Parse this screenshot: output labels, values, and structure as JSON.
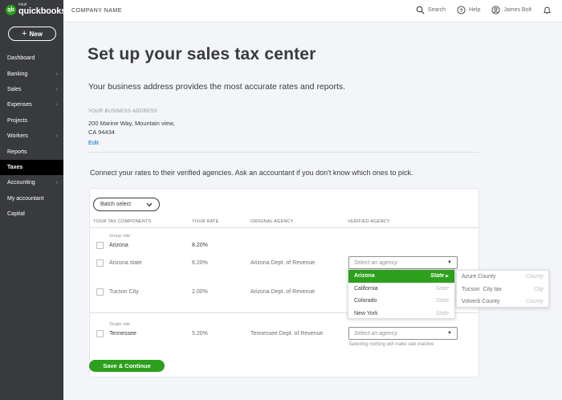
{
  "brand": {
    "intuit": "intuit",
    "name": "quickbooks",
    "mark": "qb",
    "accent": "#2ca01c"
  },
  "sidebar": {
    "new_label": "New",
    "items": [
      {
        "label": "Dashboard",
        "chevron": false
      },
      {
        "label": "Banking",
        "chevron": true
      },
      {
        "label": "Sales",
        "chevron": true
      },
      {
        "label": "Expenses",
        "chevron": true
      },
      {
        "label": "Projects",
        "chevron": false
      },
      {
        "label": "Workers",
        "chevron": true
      },
      {
        "label": "Reports",
        "chevron": false
      },
      {
        "label": "Taxes",
        "chevron": false,
        "active": true
      },
      {
        "label": "Accounting",
        "chevron": true
      },
      {
        "label": "My accountant",
        "chevron": false
      },
      {
        "label": "Capital",
        "chevron": false
      }
    ]
  },
  "topbar": {
    "company": "COMPANY NAME",
    "search": "Search",
    "help": "Help",
    "user": "James Bolt"
  },
  "page": {
    "title": "Set up your sales tax center",
    "subtitle": "Your business address provides the most accurate rates and reports.",
    "address_label": "YOUR BUSINESS ADDRESS",
    "address_line1": "200 Marine Way, Mountain view,",
    "address_line2": "CA 94434",
    "edit": "Edit",
    "connect": "Connect your rates to their verified agencies. Ask an accountant if you don't know which ones to pick."
  },
  "table": {
    "batch_label": "Batch select",
    "headers": [
      "YOUR TAX COMPONENTS",
      "YOUR RATE",
      "ORIGINAL AGENCY",
      "VERIFIED AGENCY"
    ],
    "group_label": "Group rate",
    "group_name": "Arizona",
    "group_rate": "8.20%",
    "rows": [
      {
        "name": "Arizona state",
        "rate": "6.20%",
        "agency": "Arizona Dept. of Revenue"
      },
      {
        "name": "Tucson City",
        "rate": "2.00%",
        "agency": "Arizona Dept. of Revenue"
      }
    ],
    "single_label": "Single rate",
    "single": {
      "name": "Tennessee",
      "rate": "5.20%",
      "agency": "Tennessee Dept. of Revenue"
    },
    "select_placeholder": "Select an agency",
    "select_hint": "Selecting nothing will make rate inactive"
  },
  "dropdown": {
    "items": [
      {
        "name": "Arizona",
        "type": "State",
        "selected": true
      },
      {
        "name": "California",
        "type": "State"
      },
      {
        "name": "Colorado",
        "type": "State"
      },
      {
        "name": "New York",
        "type": "State"
      }
    ],
    "submenu": [
      {
        "name": "Azure County",
        "type": "County"
      },
      {
        "name": "Tucson  City tax",
        "type": "City"
      },
      {
        "name": "Volverb County",
        "type": "County"
      }
    ]
  },
  "save_label": "Save & Continue"
}
